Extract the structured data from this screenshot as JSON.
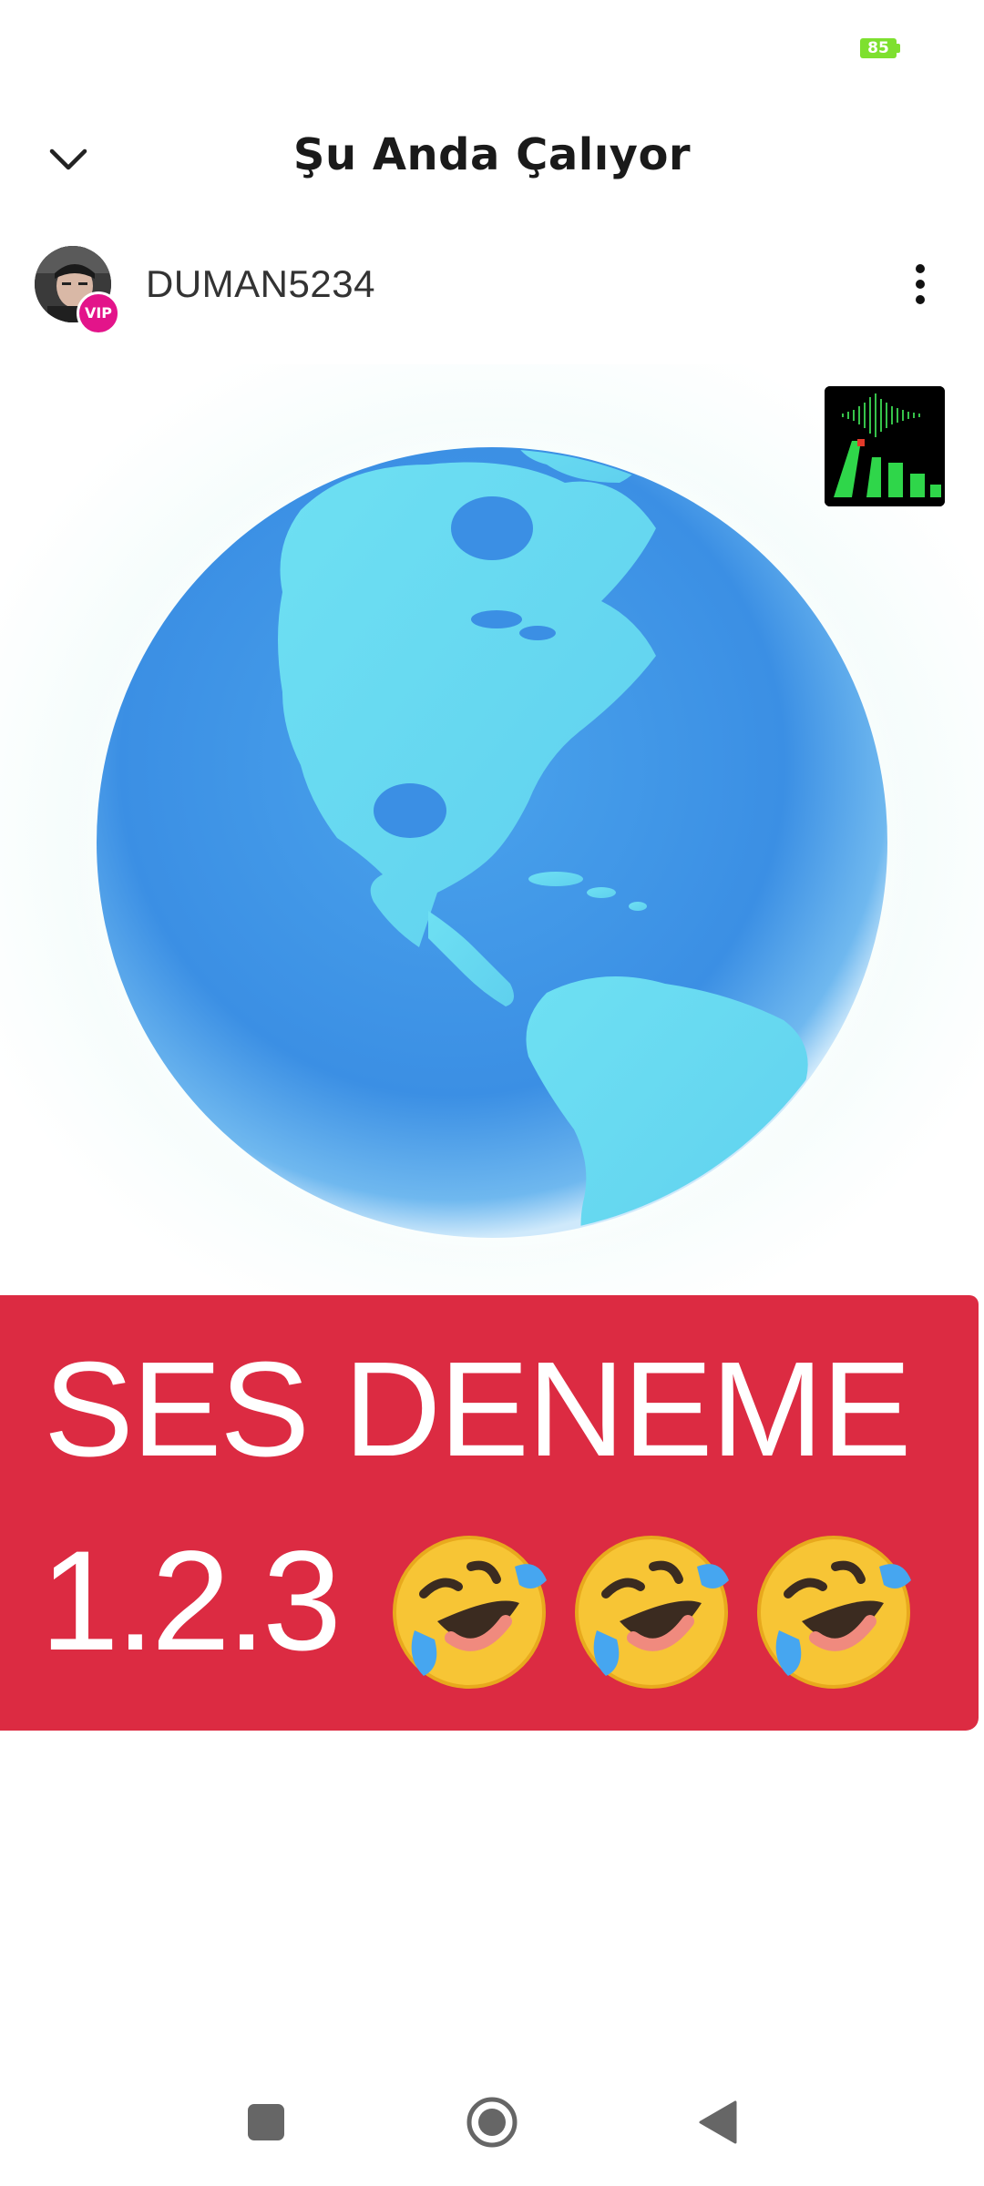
{
  "status_bar": {
    "battery_level": "85",
    "battery_color": "#7ee02f"
  },
  "header": {
    "title": "Şu Anda Çalıyor",
    "collapse_icon": "chevron-down-icon"
  },
  "user": {
    "name": "DUMAN5234",
    "badge": "VIP",
    "badge_color": "#e3148a",
    "more_icon": "more-vertical-icon"
  },
  "media": {
    "subject": "globe-icon",
    "visualizer_icon": "audio-visualizer-icon"
  },
  "caption": {
    "line1": "SES DENEME",
    "line2": "1.2.3",
    "emoji_icon": "rolling-on-floor-laughing-emoji",
    "emoji_count": 3,
    "background_color": "#dc2b42"
  },
  "nav_bar": {
    "recents_icon": "square-icon",
    "home_icon": "circle-home-icon",
    "back_icon": "triangle-back-icon"
  }
}
